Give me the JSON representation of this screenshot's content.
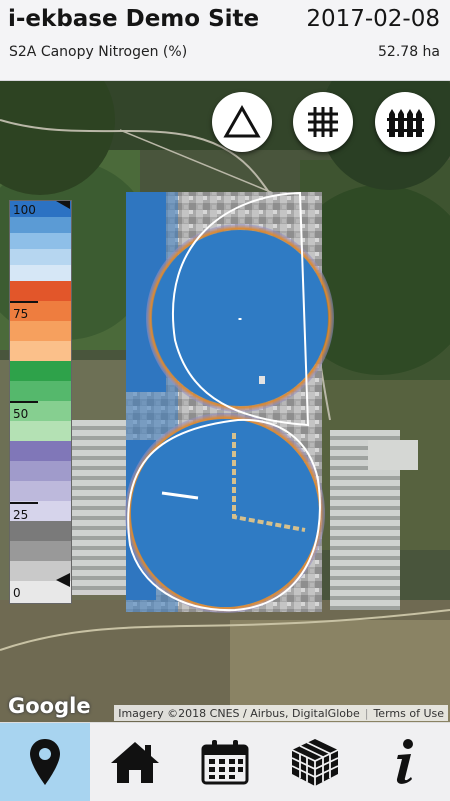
{
  "header": {
    "site_title": "i-ekbase Demo Site",
    "date": "2017-02-08",
    "layer_name": "S2A Canopy Nitrogen (%)",
    "area": "52.78 ha"
  },
  "map_tools": [
    {
      "name": "triangle-tool",
      "icon": "triangle-icon"
    },
    {
      "name": "grid-tool",
      "icon": "grid-icon"
    },
    {
      "name": "fence-tool",
      "icon": "fence-icon"
    }
  ],
  "legend": {
    "labels": [
      "100",
      "75",
      "50",
      "25",
      "0"
    ],
    "colors": {
      "blues": [
        "#2c72c3",
        "#5b9bd5",
        "#8ebfe8",
        "#b6d6f0",
        "#d6e7f6"
      ],
      "oranges": [
        "#e2562a",
        "#ee7d3f",
        "#f6a05e",
        "#fbc08a",
        "#fdd7b3"
      ],
      "greens": [
        "#2ea24a",
        "#55b86c",
        "#86cf90",
        "#b4e1b4",
        "#d8f0d4"
      ],
      "purples": [
        "#8077b8",
        "#a09bcb",
        "#bdb9dc",
        "#d6d4eb",
        "#e9e8f4"
      ],
      "greys": [
        "#7a7a7a",
        "#999999",
        "#b8b8b8",
        "#d2d2d2",
        "#e8e8e8"
      ]
    }
  },
  "map": {
    "google_logo": "Google",
    "imagery_credit": "Imagery ©2018 CNES / Airbus, DigitalGlobe",
    "terms_link": "Terms of Use"
  },
  "nav": [
    {
      "name": "nav-location",
      "icon": "map-pin-icon",
      "active": true
    },
    {
      "name": "nav-home",
      "icon": "home-icon",
      "active": false
    },
    {
      "name": "nav-calendar",
      "icon": "calendar-icon",
      "active": false
    },
    {
      "name": "nav-layers",
      "icon": "cube-icon",
      "active": false
    },
    {
      "name": "nav-info",
      "icon": "info-icon",
      "active": false
    }
  ]
}
